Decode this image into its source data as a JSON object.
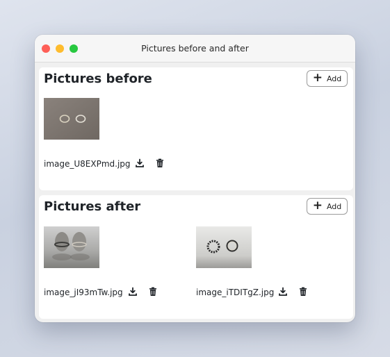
{
  "window": {
    "title": "Pictures before and after"
  },
  "sections": [
    {
      "title": "Pictures before",
      "add_label": "Add",
      "images": [
        {
          "filename": "image_U8EXPmd.jpg"
        }
      ]
    },
    {
      "title": "Pictures after",
      "add_label": "Add",
      "images": [
        {
          "filename": "image_jI93mTw.jpg"
        },
        {
          "filename": "image_iTDITgZ.jpg"
        }
      ]
    }
  ]
}
